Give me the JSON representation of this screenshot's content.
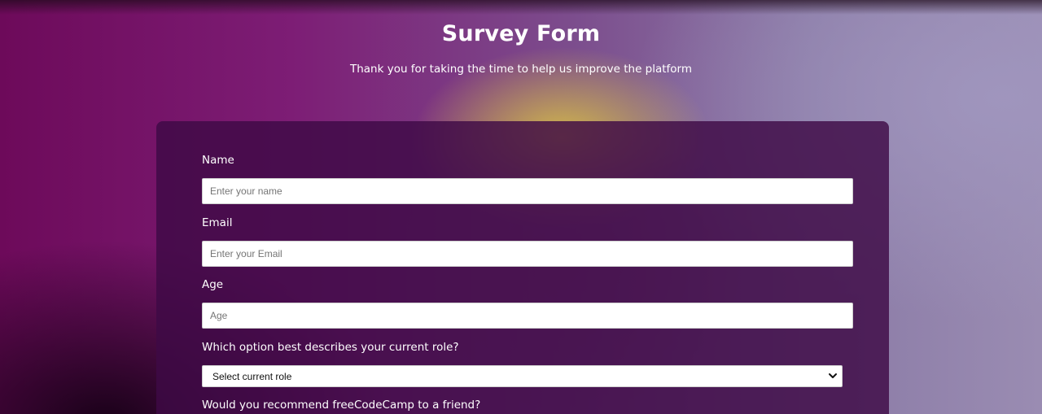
{
  "header": {
    "title": "Survey Form",
    "description": "Thank you for taking the time to help us improve the platform"
  },
  "form": {
    "name": {
      "label": "Name",
      "placeholder": "Enter your name"
    },
    "email": {
      "label": "Email",
      "placeholder": "Enter your Email"
    },
    "age": {
      "label": "Age",
      "placeholder": "Age"
    },
    "role": {
      "label": "Which option best describes your current role?",
      "selected": "Select current role",
      "icon": "chevron-down-icon"
    },
    "recommend": {
      "label": "Would you recommend freeCodeCamp to a friend?"
    }
  },
  "colors": {
    "card_background": "#3e0a46",
    "text": "#ffffff",
    "input_background": "#ffffff",
    "placeholder": "#757575"
  }
}
